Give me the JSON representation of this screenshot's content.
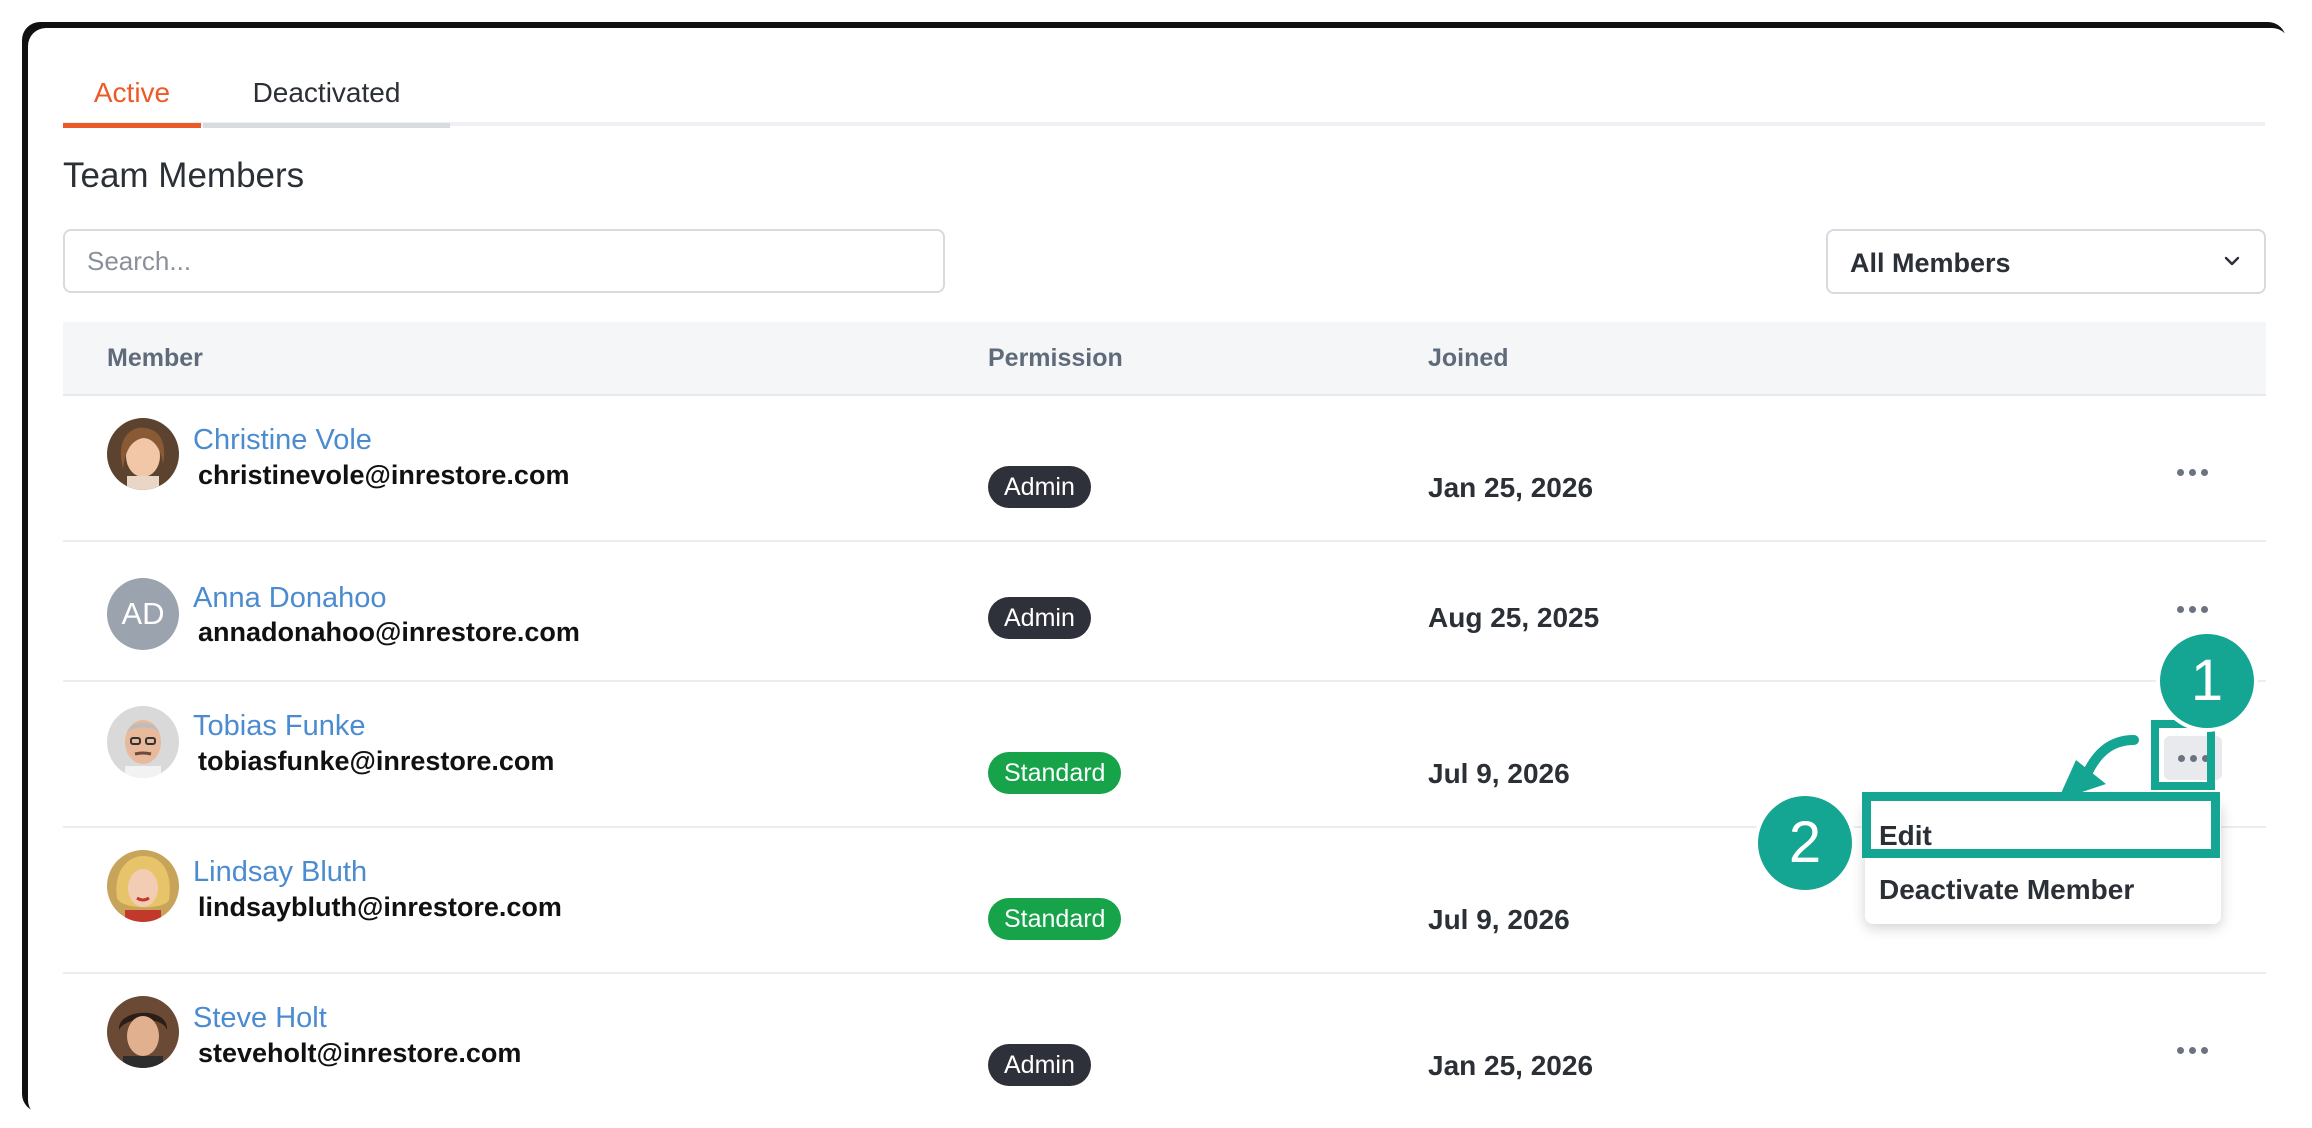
{
  "tabs": [
    {
      "label": "Active",
      "active": true
    },
    {
      "label": "Deactivated",
      "active": false
    }
  ],
  "page_title": "Team Members",
  "search": {
    "placeholder": "Search...",
    "value": ""
  },
  "filter": {
    "selected": "All Members"
  },
  "table": {
    "columns": [
      "Member",
      "Permission",
      "Joined"
    ],
    "rows": [
      {
        "name": "Christine Vole",
        "email": "christinevole@inrestore.com",
        "permission": "Admin",
        "joined": "Jan 25, 2026",
        "avatar": "photo"
      },
      {
        "name": "Anna Donahoo",
        "email": "annadonahoo@inrestore.com",
        "permission": "Admin",
        "joined": "Aug 25, 2025",
        "avatar": "initials",
        "initials": "AD"
      },
      {
        "name": "Tobias Funke",
        "email": "tobiasfunke@inrestore.com",
        "permission": "Standard",
        "joined": "Jul 9, 2026",
        "avatar": "photo"
      },
      {
        "name": "Lindsay Bluth",
        "email": "lindsaybluth@inrestore.com",
        "permission": "Standard",
        "joined": "Jul 9, 2026",
        "avatar": "photo"
      },
      {
        "name": "Steve Holt",
        "email": "steveholt@inrestore.com",
        "permission": "Admin",
        "joined": "Jan 25, 2026",
        "avatar": "photo"
      }
    ]
  },
  "menu": {
    "items": [
      "Edit",
      "Deactivate Member"
    ]
  },
  "annotations": {
    "step1": "1",
    "step2": "2"
  },
  "colors": {
    "accent": "#ec5a27",
    "link": "#4b8bd0",
    "admin_badge": "#2e3139",
    "standard_badge": "#16a34a",
    "callout": "#14a593"
  },
  "icons": {
    "filter_chevron": "chevron-down-icon",
    "row_actions": "more-horizontal-icon",
    "callout_arrow": "curved-arrow-icon"
  }
}
